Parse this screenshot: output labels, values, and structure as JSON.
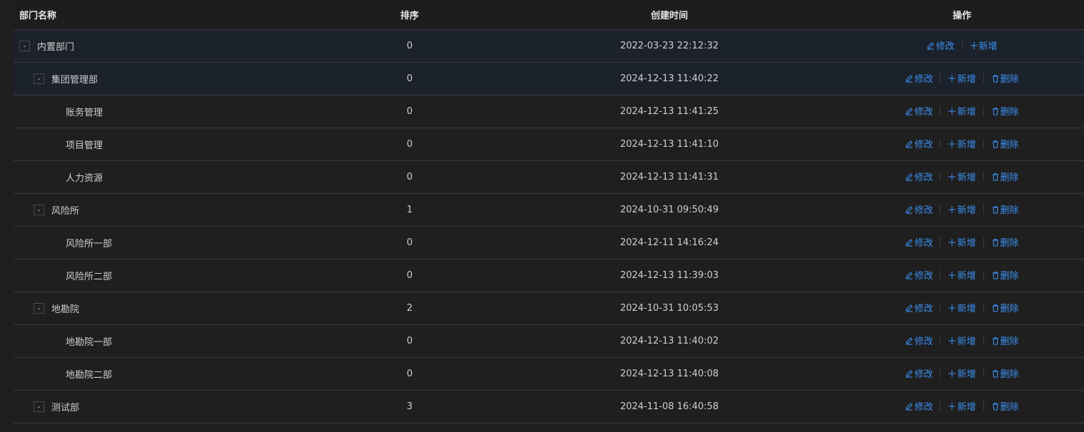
{
  "columns": {
    "name": "部门名称",
    "sort": "排序",
    "created": "创建时间",
    "actions": "操作"
  },
  "actions": {
    "edit": "修改",
    "add": "新增",
    "delete": "删除"
  },
  "rows": [
    {
      "name": "内置部门",
      "sort": "0",
      "created": "2022-03-23 22:12:32",
      "toggle": "-"
    },
    {
      "name": "集团管理部",
      "sort": "0",
      "created": "2024-12-13 11:40:22",
      "toggle": "-"
    },
    {
      "name": "账务管理",
      "sort": "0",
      "created": "2024-12-13 11:41:25"
    },
    {
      "name": "项目管理",
      "sort": "0",
      "created": "2024-12-13 11:41:10"
    },
    {
      "name": "人力资源",
      "sort": "0",
      "created": "2024-12-13 11:41:31"
    },
    {
      "name": "风险所",
      "sort": "1",
      "created": "2024-10-31 09:50:49",
      "toggle": "-"
    },
    {
      "name": "风险所一部",
      "sort": "0",
      "created": "2024-12-11 14:16:24"
    },
    {
      "name": "风险所二部",
      "sort": "0",
      "created": "2024-12-13 11:39:03"
    },
    {
      "name": "地勘院",
      "sort": "2",
      "created": "2024-10-31 10:05:53",
      "toggle": "-"
    },
    {
      "name": "地勘院一部",
      "sort": "0",
      "created": "2024-12-13 11:40:02"
    },
    {
      "name": "地勘院二部",
      "sort": "0",
      "created": "2024-12-13 11:40:08"
    },
    {
      "name": "测试部",
      "sort": "3",
      "created": "2024-11-08 16:40:58",
      "toggle": "-"
    }
  ],
  "icons": {
    "edit": "edit-icon",
    "add": "plus-icon",
    "delete": "trash-icon",
    "toggle": "collapse-toggle"
  },
  "colors": {
    "link": "#3b8ff0",
    "background": "#1f1f1f",
    "highlight_row": "#1c222b"
  }
}
